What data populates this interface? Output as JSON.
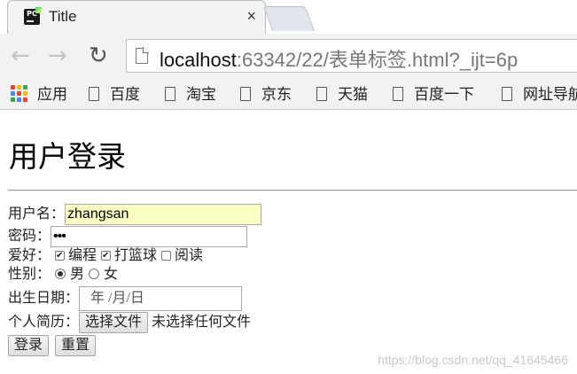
{
  "browser": {
    "tab": {
      "title": "Title",
      "favicon": "pycharm-icon",
      "close": "×"
    },
    "nav": {
      "back": "←",
      "forward": "→",
      "reload": "↻"
    },
    "address": {
      "host": "localhost",
      "rest": ":63342/22/表单标签.html?_ijt=6p"
    },
    "bookmarks": [
      {
        "label": "应用",
        "icon": "apps-grid-icon"
      },
      {
        "label": "百度",
        "icon": "document-icon"
      },
      {
        "label": "淘宝",
        "icon": "document-icon"
      },
      {
        "label": "京东",
        "icon": "document-icon"
      },
      {
        "label": "天猫",
        "icon": "document-icon"
      },
      {
        "label": "百度一下",
        "icon": "document-icon"
      },
      {
        "label": "网址导航",
        "icon": "document-icon"
      }
    ]
  },
  "page": {
    "heading": "用户登录",
    "form": {
      "username_label": "用户名：",
      "username_value": "zhangsan",
      "password_label": "密码：",
      "password_value": "•••",
      "hobby_label": "爱好：",
      "hobbies": [
        {
          "label": "编程",
          "checked": true
        },
        {
          "label": "打篮球",
          "checked": true
        },
        {
          "label": "阅读",
          "checked": false
        }
      ],
      "gender_label": "性别：",
      "genders": [
        {
          "label": "男",
          "selected": true
        },
        {
          "label": "女",
          "selected": false
        }
      ],
      "birthdate_label": "出生日期：",
      "birthdate_placeholder": "年 /月/日",
      "resume_label": "个人简历：",
      "file_button": "选择文件",
      "file_status": "未选择任何文件",
      "submit_label": "登录",
      "reset_label": "重置"
    },
    "watermark": "https://blog.csdn.net/qq_41645466"
  },
  "colors": {
    "autofill": "#fbffc4",
    "chrome_bg": "#f2f2f2"
  }
}
